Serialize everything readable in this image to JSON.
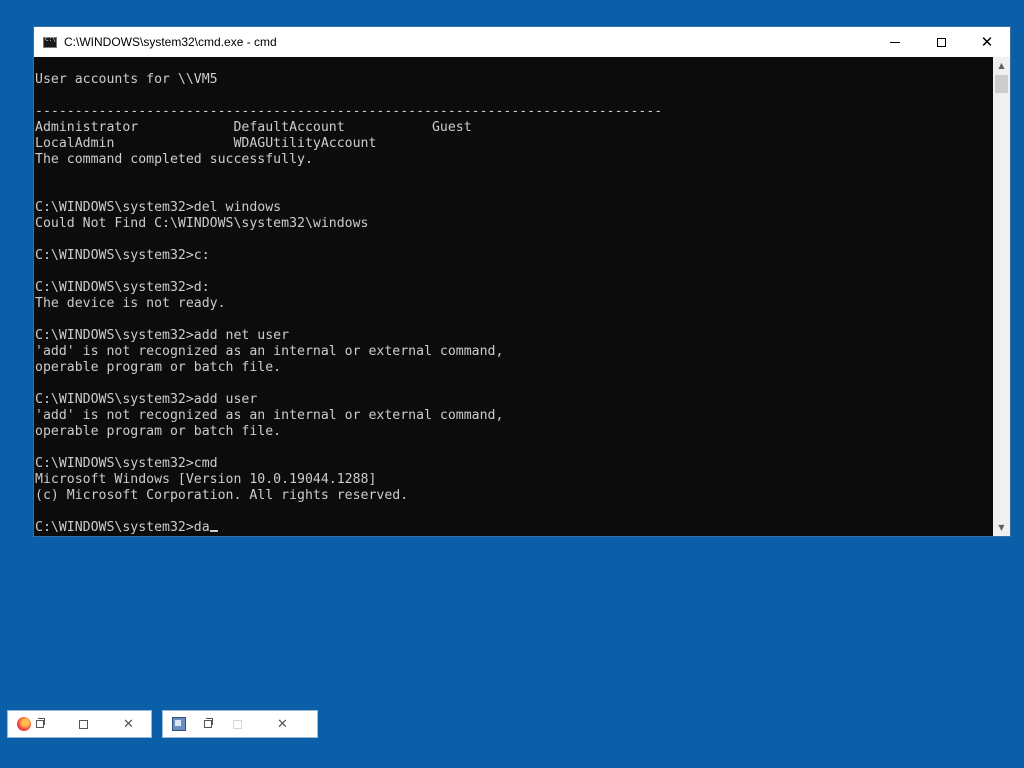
{
  "window": {
    "title": "C:\\WINDOWS\\system32\\cmd.exe - cmd",
    "minimize_glyph": "",
    "close_glyph": "✕"
  },
  "console": {
    "lines": [
      "User accounts for \\\\VM5",
      "",
      "-------------------------------------------------------------------------------",
      "Administrator            DefaultAccount           Guest",
      "LocalAdmin               WDAGUtilityAccount",
      "The command completed successfully.",
      "",
      "",
      "C:\\WINDOWS\\system32>del windows",
      "Could Not Find C:\\WINDOWS\\system32\\windows",
      "",
      "C:\\WINDOWS\\system32>c:",
      "",
      "C:\\WINDOWS\\system32>d:",
      "The device is not ready.",
      "",
      "C:\\WINDOWS\\system32>add net user",
      "'add' is not recognized as an internal or external command,",
      "operable program or batch file.",
      "",
      "C:\\WINDOWS\\system32>add user",
      "'add' is not recognized as an internal or external command,",
      "operable program or batch file.",
      "",
      "C:\\WINDOWS\\system32>cmd",
      "Microsoft Windows [Version 10.0.19044.1288]",
      "(c) Microsoft Corporation. All rights reserved.",
      ""
    ],
    "current_prompt": "C:\\WINDOWS\\system32>da"
  },
  "minimized": {
    "firefox": {
      "icon": "firefox-icon",
      "close_glyph": "✕"
    },
    "app2": {
      "icon": "app-window-icon",
      "close_glyph": "✕"
    }
  }
}
